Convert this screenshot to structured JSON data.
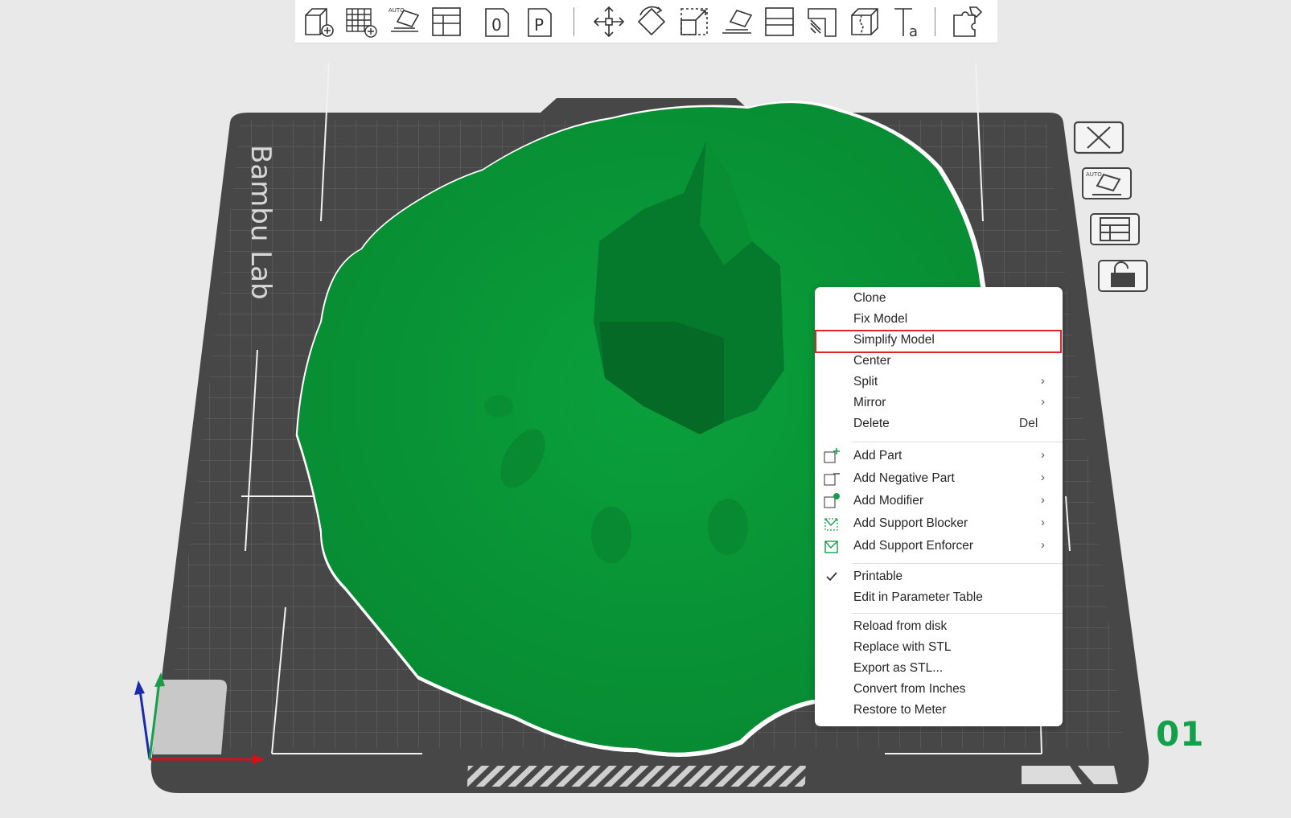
{
  "toolbar": {
    "buttons": [
      {
        "name": "add-object-button",
        "icon": "cube-plus-icon"
      },
      {
        "name": "add-plate-button",
        "icon": "grid-plus-icon"
      },
      {
        "name": "auto-orient-button",
        "icon": "auto-orient-icon"
      },
      {
        "name": "arrange-button",
        "icon": "arrange-icon"
      },
      {
        "name": "split-objects-button",
        "icon": "split-to-objects-icon"
      },
      {
        "name": "split-parts-button",
        "icon": "split-to-parts-icon"
      },
      {
        "name": "move-button",
        "icon": "move-arrows-icon"
      },
      {
        "name": "rotate-button",
        "icon": "rotate-icon"
      },
      {
        "name": "scale-button",
        "icon": "scale-icon"
      },
      {
        "name": "lay-on-face-button",
        "icon": "lay-on-face-icon"
      },
      {
        "name": "cut-button",
        "icon": "cut-icon"
      },
      {
        "name": "support-paint-button",
        "icon": "support-paint-icon"
      },
      {
        "name": "seam-paint-button",
        "icon": "seam-paint-icon"
      },
      {
        "name": "text-button",
        "icon": "text-icon"
      },
      {
        "name": "assembly-button",
        "icon": "puzzle-icon"
      }
    ]
  },
  "plate": {
    "brand": "Bambu Lab",
    "number": "01",
    "model_color": "#0a9b3a",
    "bed_color": "#4a4a4a",
    "accent": "#12a04a"
  },
  "plate_controls": [
    {
      "name": "delete-plate-button",
      "icon": "close-x-icon"
    },
    {
      "name": "plate-auto-orient-button",
      "icon": "auto-orient-icon"
    },
    {
      "name": "plate-arrange-button",
      "icon": "arrange-icon"
    },
    {
      "name": "lock-plate-button",
      "icon": "unlock-icon"
    }
  ],
  "context_menu": {
    "items": [
      {
        "label": "Clone"
      },
      {
        "label": "Fix Model"
      },
      {
        "label": "Simplify Model",
        "highlighted": true
      },
      {
        "label": "Center"
      },
      {
        "label": "Split",
        "submenu": true
      },
      {
        "label": "Mirror",
        "submenu": true
      },
      {
        "label": "Delete",
        "shortcut": "Del"
      },
      {
        "label": "Add Part",
        "submenu": true,
        "icon": "add-part-icon"
      },
      {
        "label": "Add Negative Part",
        "submenu": true,
        "icon": "add-negative-part-icon"
      },
      {
        "label": "Add Modifier",
        "submenu": true,
        "icon": "add-modifier-icon"
      },
      {
        "label": "Add Support Blocker",
        "submenu": true,
        "icon": "support-blocker-icon"
      },
      {
        "label": "Add Support Enforcer",
        "submenu": true,
        "icon": "support-enforcer-icon"
      },
      {
        "label": "Printable",
        "checked": true,
        "icon": "checkmark-icon"
      },
      {
        "label": "Edit in Parameter Table"
      },
      {
        "label": "Reload from disk"
      },
      {
        "label": "Replace with STL"
      },
      {
        "label": "Export as STL..."
      },
      {
        "label": "Convert from Inches"
      },
      {
        "label": "Restore to Meter"
      }
    ],
    "submenu_arrow": "›",
    "highlight_color": "#e0242b"
  }
}
